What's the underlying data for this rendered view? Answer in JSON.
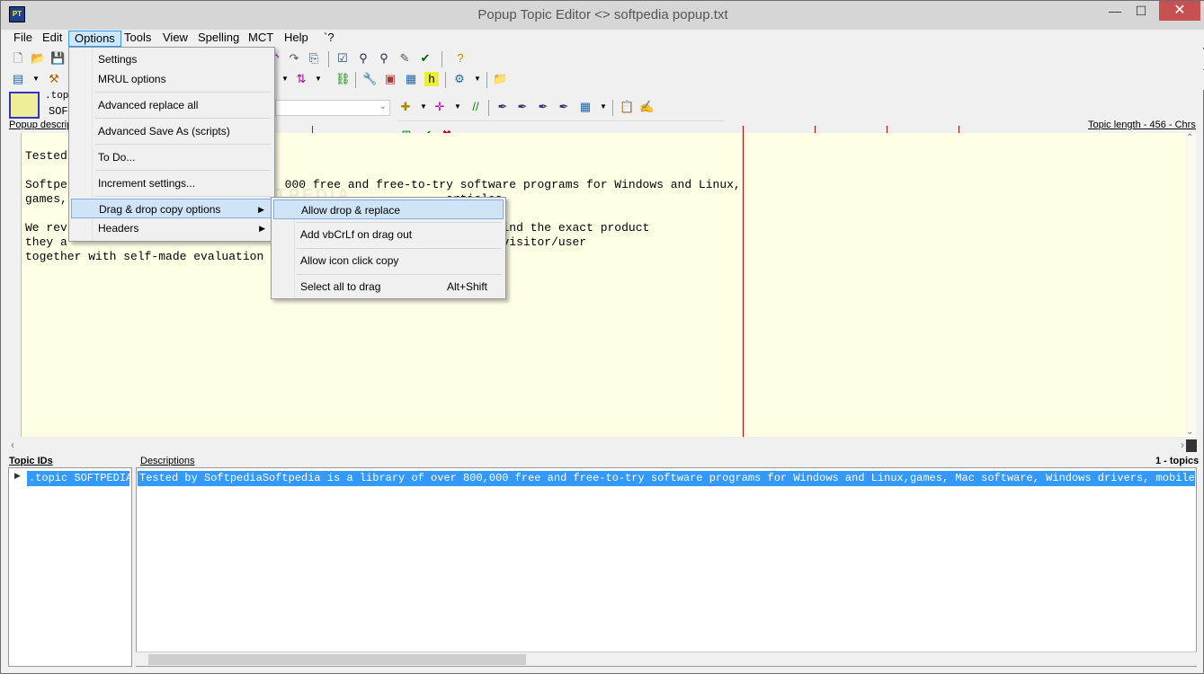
{
  "window": {
    "title": "Popup Topic Editor <> softpedia popup.txt",
    "minimize_glyph": "—",
    "maximize_glyph": "☐",
    "close_glyph": "✕"
  },
  "menubar": {
    "items": [
      {
        "label": "File"
      },
      {
        "label": "Edit"
      },
      {
        "label": "Options"
      },
      {
        "label": "Tools"
      },
      {
        "label": "View"
      },
      {
        "label": "Spelling"
      },
      {
        "label": "MCT"
      },
      {
        "label": "Help"
      },
      {
        "label": "`?"
      }
    ]
  },
  "options_menu": {
    "items": [
      {
        "label": "Settings"
      },
      {
        "label": "MRUL options"
      },
      {
        "label": "Advanced replace all"
      },
      {
        "label": "Advanced Save As (scripts)"
      },
      {
        "label": "To Do..."
      },
      {
        "label": "Increment settings..."
      },
      {
        "label": "Drag & drop copy options",
        "arrow": "▶"
      },
      {
        "label": "Headers",
        "arrow": "▶"
      }
    ]
  },
  "drag_drop_submenu": {
    "items": [
      {
        "label": "Allow drop & replace"
      },
      {
        "label": "Add vbCrLf on drag out"
      },
      {
        "label": "Allow icon click copy"
      },
      {
        "label": "Select all to drag",
        "shortcut": "Alt+Shift"
      }
    ]
  },
  "topic_header": {
    "id_label": ".topic",
    "id_value": "SOFT",
    "popup_desc_label": "Popup descrip",
    "topic_length": "Topic length - 456 - Chrs"
  },
  "editor": {
    "lines": [
      "Tested",
      "",
      "Softpe                               000 free and free-to-try software programs for Windows and Linux,",
      "games,                                                      articles.",
      "",
      "We rev                                                  or/user to find the exact product",
      "they a                                                 ducts to the visitor/user",
      "together with self-made evaluation"
    ]
  },
  "lower": {
    "topic_ids_label": "Topic IDs",
    "descriptions_label": "Descriptions",
    "topic_count": "1 - topics",
    "topic_row": ".topic SOFTPEDIA",
    "description_row": "Tested by SoftpediaSoftpedia is a library of over 800,000 free and free-to-try software programs for Windows and Linux,games, Mac software, Windows drivers, mobile devi"
  },
  "watermark": "SOFTPEDIA"
}
